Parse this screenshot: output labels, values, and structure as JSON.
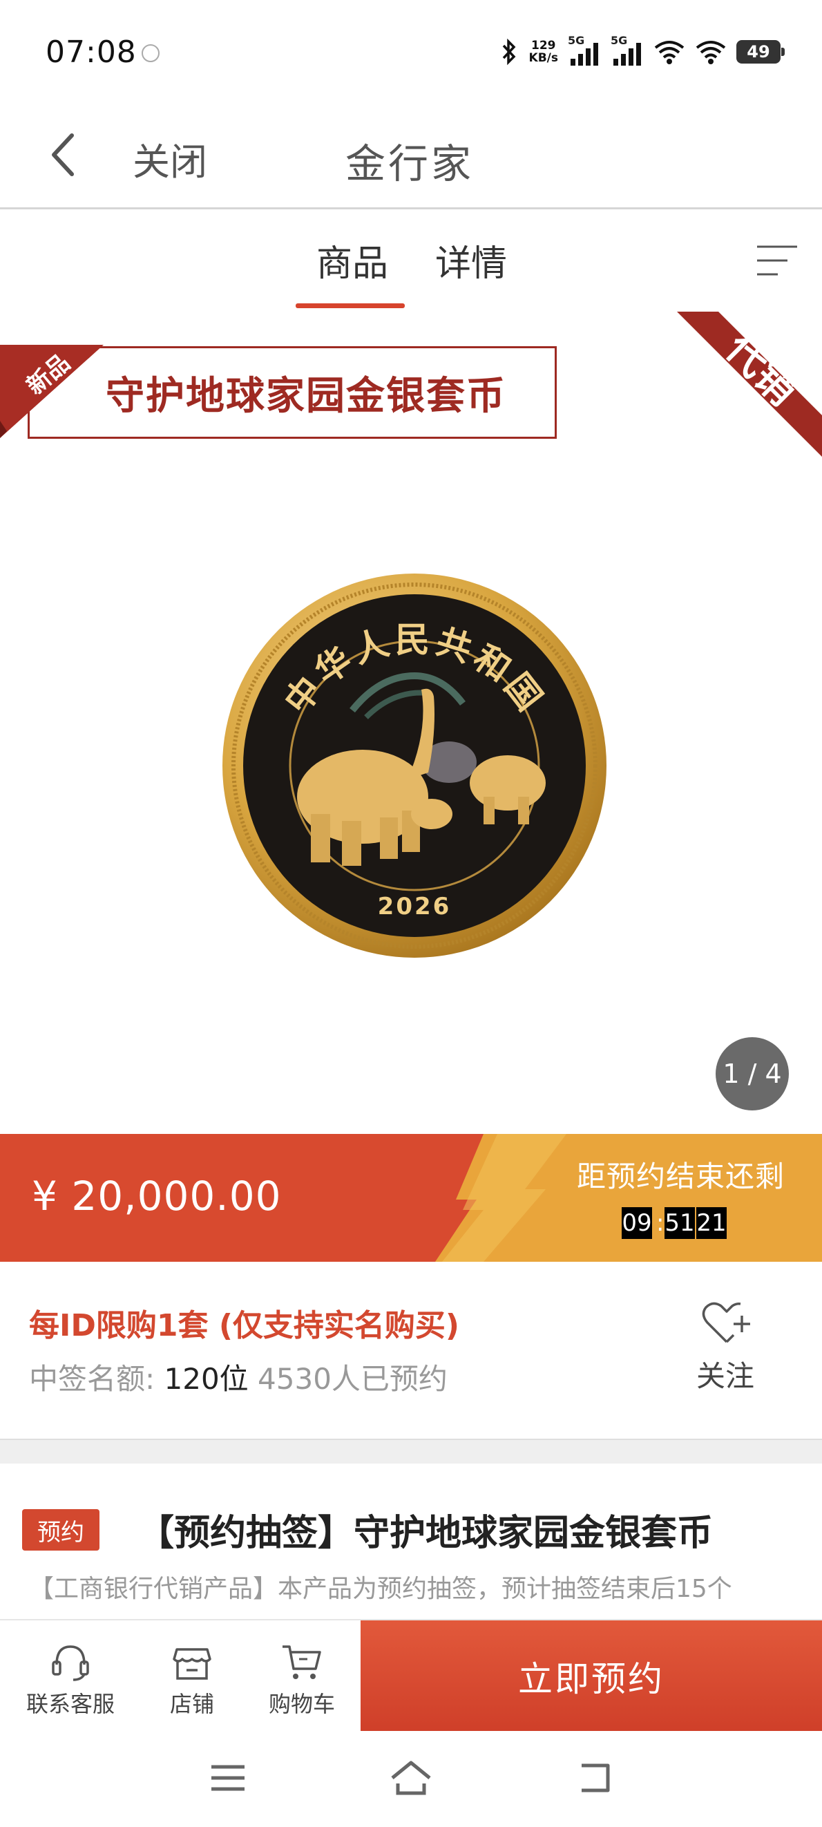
{
  "status_bar": {
    "time": "07:08",
    "net_speed_value": "129",
    "net_speed_unit": "KB/s",
    "signal1": "5G",
    "signal2": "5G",
    "battery": "49"
  },
  "nav": {
    "close_label": "关闭",
    "title": "金行家"
  },
  "tabs": [
    {
      "label": "商品",
      "active": true
    },
    {
      "label": "详情",
      "active": false
    }
  ],
  "hero": {
    "banner_title": "守护地球家园金银套币",
    "new_badge": "新品",
    "corner_badge": "代销",
    "coin_top_text": "中华人民共和国",
    "coin_year": "2026",
    "image_counter": "1 / 4"
  },
  "price_bar": {
    "price": "¥ 20,000.00",
    "countdown_label": "距预约结束还剩",
    "hours": "09",
    "minutes": "51",
    "seconds": "21"
  },
  "limit": {
    "text": "每ID限购1套 (仅支持实名购买)",
    "quota_label": "中签名额:",
    "quota_value": "120位",
    "reserved": "4530人已预约",
    "follow_label": "关注"
  },
  "product": {
    "tag": "预约",
    "title": "【预约抽签】守护地球家园金银套币",
    "description": "【工商银行代销产品】本产品为预约抽签，预计抽签结束后15个"
  },
  "actions": {
    "service": "联系客服",
    "shop": "店铺",
    "cart": "购物车",
    "reserve": "立即预约"
  },
  "colors": {
    "accent": "#d84a2f",
    "ribbon": "#9e2a22",
    "gold": "#e7a83d"
  }
}
